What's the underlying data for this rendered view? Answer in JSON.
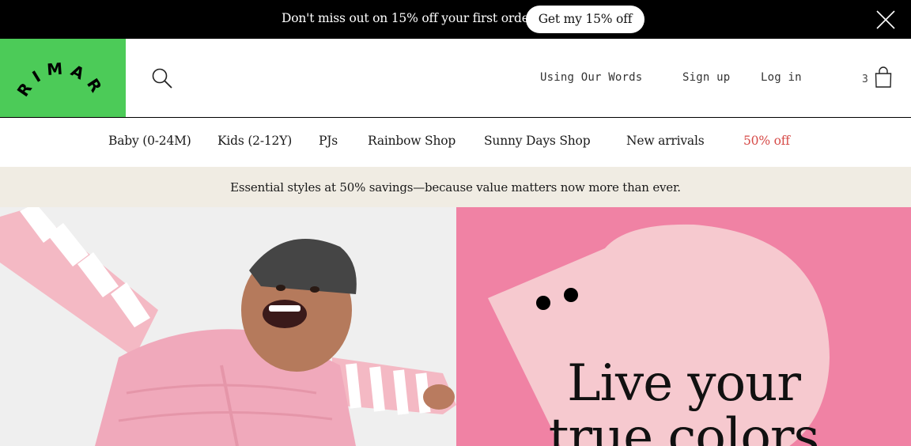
{
  "promo": {
    "message": "Don't miss out on 15% off your first order!",
    "cta": "Get my 15% off",
    "close_icon": "close-icon"
  },
  "header": {
    "logo_text": "PRIMARY",
    "search_icon": "search-icon",
    "links": {
      "words": "Using Our Words",
      "signup": "Sign up",
      "login": "Log in"
    },
    "cart_count": "3",
    "bag_icon": "shopping-bag-icon"
  },
  "nav": {
    "items": [
      "Baby (0-24M)",
      "Kids (2-12Y)",
      "PJs",
      "Rainbow Shop",
      "Sunny Days Shop",
      "New arrivals",
      "50% off"
    ]
  },
  "notice": {
    "text": "Essential styles at 50% savings—because value matters now more than ever."
  },
  "hero": {
    "line1": "Live your",
    "line2": "true colors"
  },
  "colors": {
    "brand_green": "#4ccb58",
    "hero_pink": "#f082a4",
    "shape_pink": "#f6c9cf",
    "sale_red": "#d64a47",
    "notice_bg": "#f0ece3"
  }
}
